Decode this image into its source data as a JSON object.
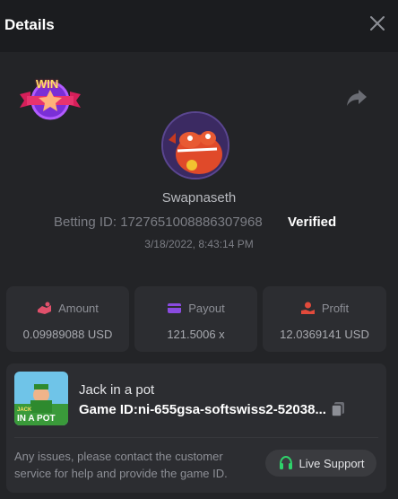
{
  "header": {
    "title": "Details"
  },
  "profile": {
    "badge_text": "WIN",
    "username": "Swapnaseth",
    "betting_id_label": "Betting ID: 1727651008886307968",
    "verified_label": "Verified",
    "datetime": "3/18/2022, 8:43:14 PM"
  },
  "stats": {
    "amount": {
      "label": "Amount",
      "value": "0.09989088 USD"
    },
    "payout": {
      "label": "Payout",
      "value": "121.5006 x"
    },
    "profit": {
      "label": "Profit",
      "value": "12.0369141 USD"
    }
  },
  "game": {
    "thumb_line1": "JACK",
    "thumb_line2": "IN A POT",
    "name": "Jack in a pot",
    "id_label": "Game ID:",
    "id_value": "ni-655gsa-softswiss2-52038..."
  },
  "support": {
    "issue_text": "Any issues, please contact the customer service for help and provide the game ID.",
    "button_label": "Live Support"
  },
  "colors": {
    "amount_icon": "#e0506b",
    "payout_icon": "#8a4be0",
    "profit_icon": "#e24a3b",
    "support_icon": "#2fd46b",
    "verified": "#ffffff"
  }
}
